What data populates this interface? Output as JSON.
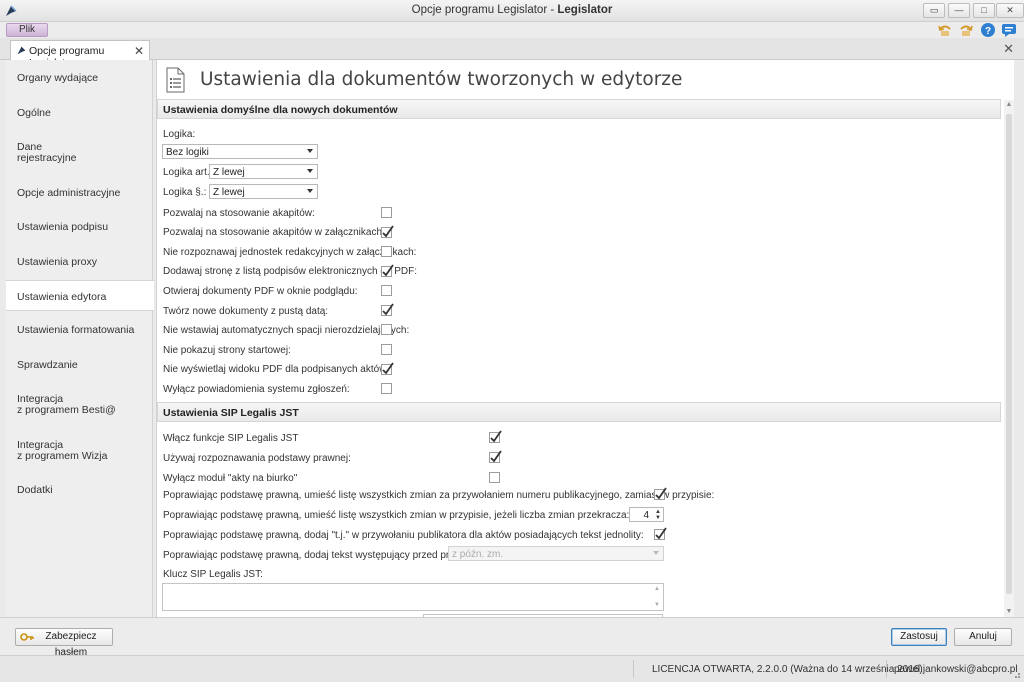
{
  "window": {
    "title_prefix": "Opcje programu Legislator - ",
    "title_app": "Legislator"
  },
  "menu": {
    "file_label": "Plik"
  },
  "toolbar_icons": [
    "undo-icon",
    "redo-icon",
    "help-icon",
    "message-icon"
  ],
  "document_tab": {
    "label": "Opcje programu Legislator"
  },
  "sidebar": {
    "items": [
      {
        "label": "Organy wydające"
      },
      {
        "label": "Ogólne"
      },
      {
        "label": "Dane\nrejestracyjne"
      },
      {
        "label": "Opcje administracyjne"
      },
      {
        "label": "Ustawienia podpisu"
      },
      {
        "label": "Ustawienia proxy"
      },
      {
        "label": "Ustawienia edytora",
        "active": true
      },
      {
        "label": "Ustawienia formatowania"
      },
      {
        "label": "Sprawdzanie"
      },
      {
        "label": "Integracja\nz programem Besti@"
      },
      {
        "label": "Integracja\nz programem Wizja"
      },
      {
        "label": "Dodatki"
      }
    ]
  },
  "page": {
    "title": "Ustawienia dla dokumentów tworzonych w edytorze"
  },
  "section_defaults": {
    "header": "Ustawienia domyślne dla nowych dokumentów",
    "logika_label": "Logika:",
    "logika_value": "Bez logiki",
    "logika_art_label": "Logika art.:",
    "logika_art_value": "Z lewej",
    "logika_par_label": "Logika §.:",
    "logika_par_value": "Z lewej",
    "options": [
      {
        "label": "Pozwalaj na stosowanie akapitów:",
        "checked": false
      },
      {
        "label": "Pozwalaj na stosowanie akapitów w załącznikach:",
        "checked": true
      },
      {
        "label": "Nie rozpoznawaj jednostek redakcyjnych w załącznikach:",
        "checked": false
      },
      {
        "label": "Dodawaj stronę z listą podpisów elektronicznych do PDF:",
        "checked": true
      },
      {
        "label": "Otwieraj dokumenty PDF w oknie podglądu:",
        "checked": false
      },
      {
        "label": "Twórz nowe dokumenty z pustą datą:",
        "checked": true
      },
      {
        "label": "Nie wstawiaj automatycznych spacji nierozdzielających:",
        "checked": false
      },
      {
        "label": "Nie pokazuj strony startowej:",
        "checked": false
      },
      {
        "label": "Nie wyświetlaj widoku PDF dla podpisanych aktów",
        "checked": true
      },
      {
        "label": "Wyłącz powiadomienia systemu zgłoszeń:",
        "checked": false
      }
    ]
  },
  "section_sip": {
    "header": "Ustawienia SIP Legalis JST",
    "options": [
      {
        "label": "Włącz funkcje SIP Legalis JST",
        "checked": true
      },
      {
        "label": "Używaj rozpoznawania podstawy prawnej:",
        "checked": true
      },
      {
        "label": "Wyłącz moduł \"akty na biurko\"",
        "checked": false
      }
    ],
    "long_options": [
      {
        "label": "Poprawiając podstawę prawną, umieść listę wszystkich zmian za przywołaniem numeru publikacyjnego, zamiast w przypisie:",
        "checked": true
      },
      {
        "label": "Poprawiając podstawę prawną, umieść listę wszystkich zmian w przypisie, jeżeli liczba zmian przekracza:"
      },
      {
        "label": "Poprawiając podstawę prawną, dodaj \"t.j.\" w przywołaniu publikatora dla aktów posiadających tekst jednolity:",
        "checked": true
      },
      {
        "label": "Poprawiając podstawę prawną, dodaj tekst występujący przed przypisem:"
      }
    ],
    "changes_threshold": "4",
    "prefix_text_value": "z późn. zm.",
    "key_label": "Klucz SIP Legalis JST:",
    "key_value": ""
  },
  "buttons": {
    "protect_label": "Zabezpiecz hasłem",
    "apply_label": "Zastosuj",
    "cancel_label": "Anuluj"
  },
  "status": {
    "license": "LICENCJA OTWARTA, 2.2.0.0 (Ważna do 14 września 2016)",
    "user": "pawel.jankowski@abcpro.pl"
  },
  "colors": {
    "accent": "#3d7fbd",
    "file_menu": "#cdb4d6",
    "help": "#2f7fd0"
  }
}
